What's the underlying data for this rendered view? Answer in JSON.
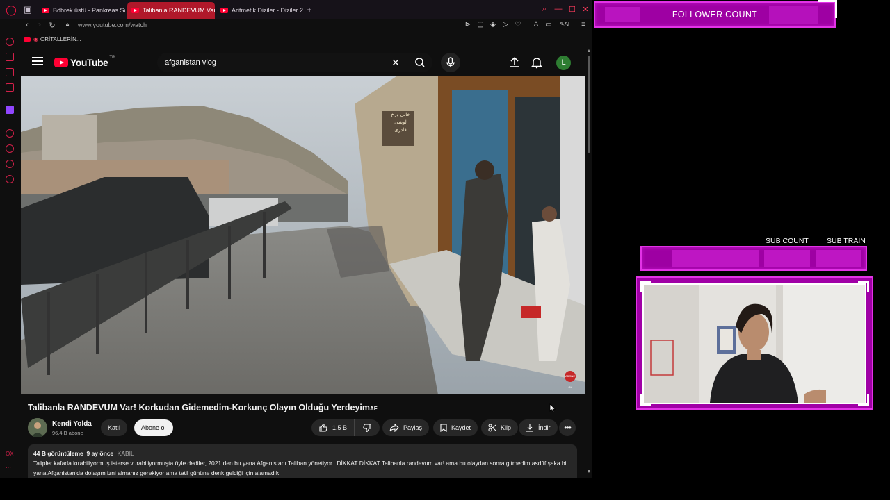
{
  "browser": {
    "tabs": [
      {
        "title": "Böbrek üstü - Pankreas Sc",
        "active": false
      },
      {
        "title": "Talibanla RANDEVUM Var!",
        "active": true
      },
      {
        "title": "Aritmetik Diziler - Diziler 2",
        "active": false
      }
    ],
    "url": "www.youtube.com/watch",
    "ai_label": "AI",
    "bookmark": "ORİTALLERİN...",
    "sidebar_bottom": "OX"
  },
  "youtube": {
    "region": "TR",
    "logo_text": "YouTube",
    "search_value": "afganistan vlog",
    "avatar_letter": "L",
    "video_title": "Talibanla RANDEVUM Var! Korkudan Gidemedim-Korkunç Olayın Olduğu Yerdeyim",
    "title_flag": "AF",
    "channel": {
      "name": "Kendi Yolda",
      "subscribers": "96,4 B abone"
    },
    "buttons": {
      "join": "Katıl",
      "subscribe": "Abone ol",
      "likes": "1,5 B",
      "share": "Paylaş",
      "save": "Kaydet",
      "clip": "Klip",
      "download": "İndir"
    },
    "description": {
      "views": "44 B görüntüleme",
      "age": "9 ay önce",
      "tag": "KABİL",
      "text": "Talipler kafada kırabiliyormuş isterse vurabiliyormuşta öyle dediler, 2021 den bu yana Afganistanı Taliban yönetiyor.. DİKKAT DİKKAT Talibanla randevum var! ama bu olaydan sonra gitmedim asdfff şaka bi yana Afganistan'da dolaşım izni almanız gerekiyor ama tatil gününe denk geldiği için alamadık"
    },
    "shop_signs": [
      "خانی ورخ لوښی",
      "قادری"
    ],
    "watermark": "ABONE OL"
  },
  "overlay": {
    "follower_count_label": "FOLLOWER COUNT",
    "sub_count_label": "SUB COUNT",
    "sub_train_label": "SUB TRAIN",
    "accent": "#e233e6",
    "fill": "#9e00a3"
  }
}
